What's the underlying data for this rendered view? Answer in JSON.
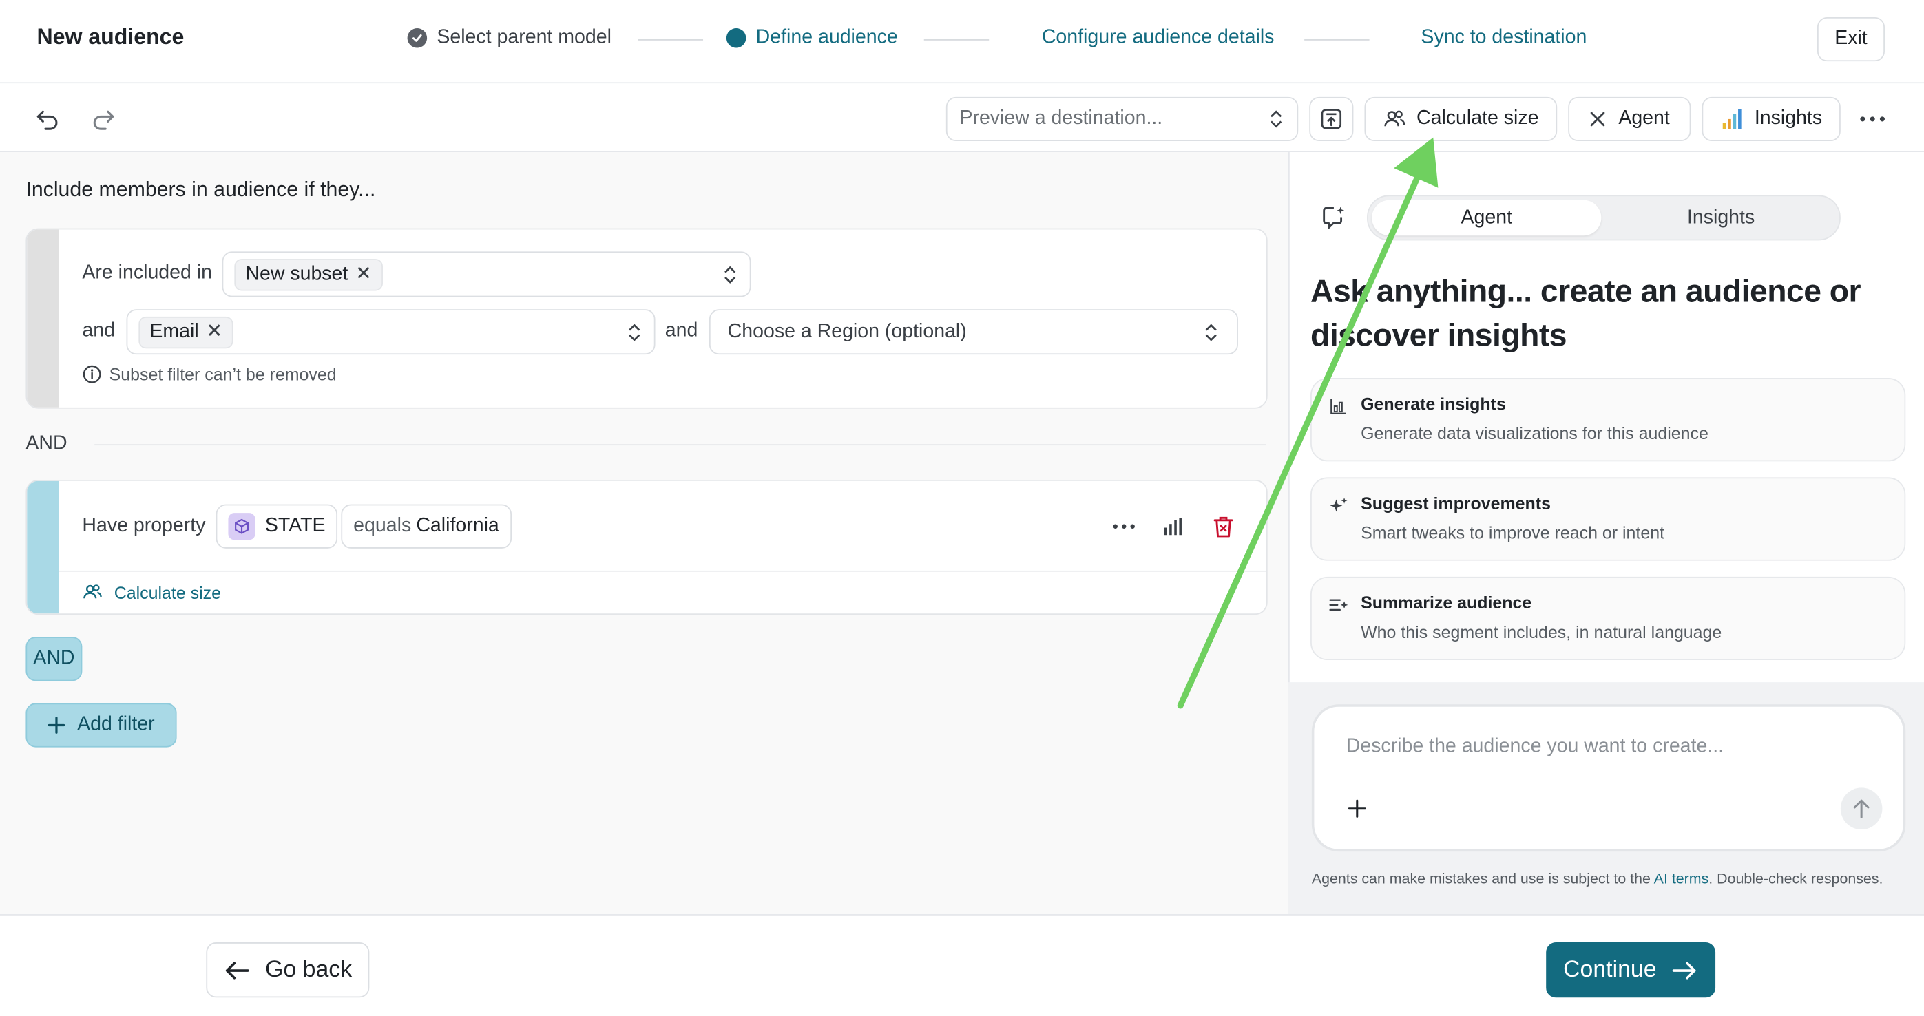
{
  "header": {
    "title": "New audience",
    "steps": [
      {
        "label": "Select parent model",
        "state": "done"
      },
      {
        "label": "Define audience",
        "state": "active"
      },
      {
        "label": "Configure audience details",
        "state": "upcoming"
      },
      {
        "label": "Sync to destination",
        "state": "upcoming"
      }
    ],
    "exit_label": "Exit"
  },
  "toolbar": {
    "undo_icon": "undo-icon",
    "redo_icon": "redo-icon",
    "preview_placeholder": "Preview a destination...",
    "calculate_size_label": "Calculate size",
    "agent_label": "Agent",
    "insights_label": "Insights"
  },
  "builder": {
    "section_title": "Include members in audience if they...",
    "subset_condition": {
      "included_label": "Are included in",
      "subset_chip": "New subset",
      "and_label_1": "and",
      "channel_chip": "Email",
      "and_label_2": "and",
      "region_placeholder": "Choose a Region (optional)",
      "note": "Subset filter can’t be removed"
    },
    "and_separator": "AND",
    "property_condition": {
      "have_label": "Have property",
      "property_name": "STATE",
      "operator": "equals",
      "value": "California",
      "calculate_size_label": "Calculate size"
    },
    "and_badge": "AND",
    "add_filter_label": "Add filter"
  },
  "agent_panel": {
    "tabs": [
      "Agent",
      "Insights"
    ],
    "active_tab": "Agent",
    "headline": "Ask anything... create an audience or discover insights",
    "suggestions": [
      {
        "title": "Generate insights",
        "description": "Generate data visualizations for this audience",
        "icon": "chart-icon"
      },
      {
        "title": "Suggest improvements",
        "description": "Smart tweaks to improve reach or intent",
        "icon": "sparkle-icon"
      },
      {
        "title": "Summarize audience",
        "description": "Who this segment includes, in natural language",
        "icon": "list-sparkle-icon"
      }
    ],
    "chat_placeholder": "Describe the audience you want to create...",
    "disclaimer_before": "Agents can make mistakes and use is subject to the ",
    "disclaimer_link": "AI terms",
    "disclaimer_after": ". Double-check responses."
  },
  "footer": {
    "go_back_label": "Go back",
    "continue_label": "Continue"
  },
  "colors": {
    "accent": "#136b80",
    "accent_light": "#a9d9e6",
    "delete_red": "#c8102e",
    "annotation_arrow": "#6fd05f"
  }
}
